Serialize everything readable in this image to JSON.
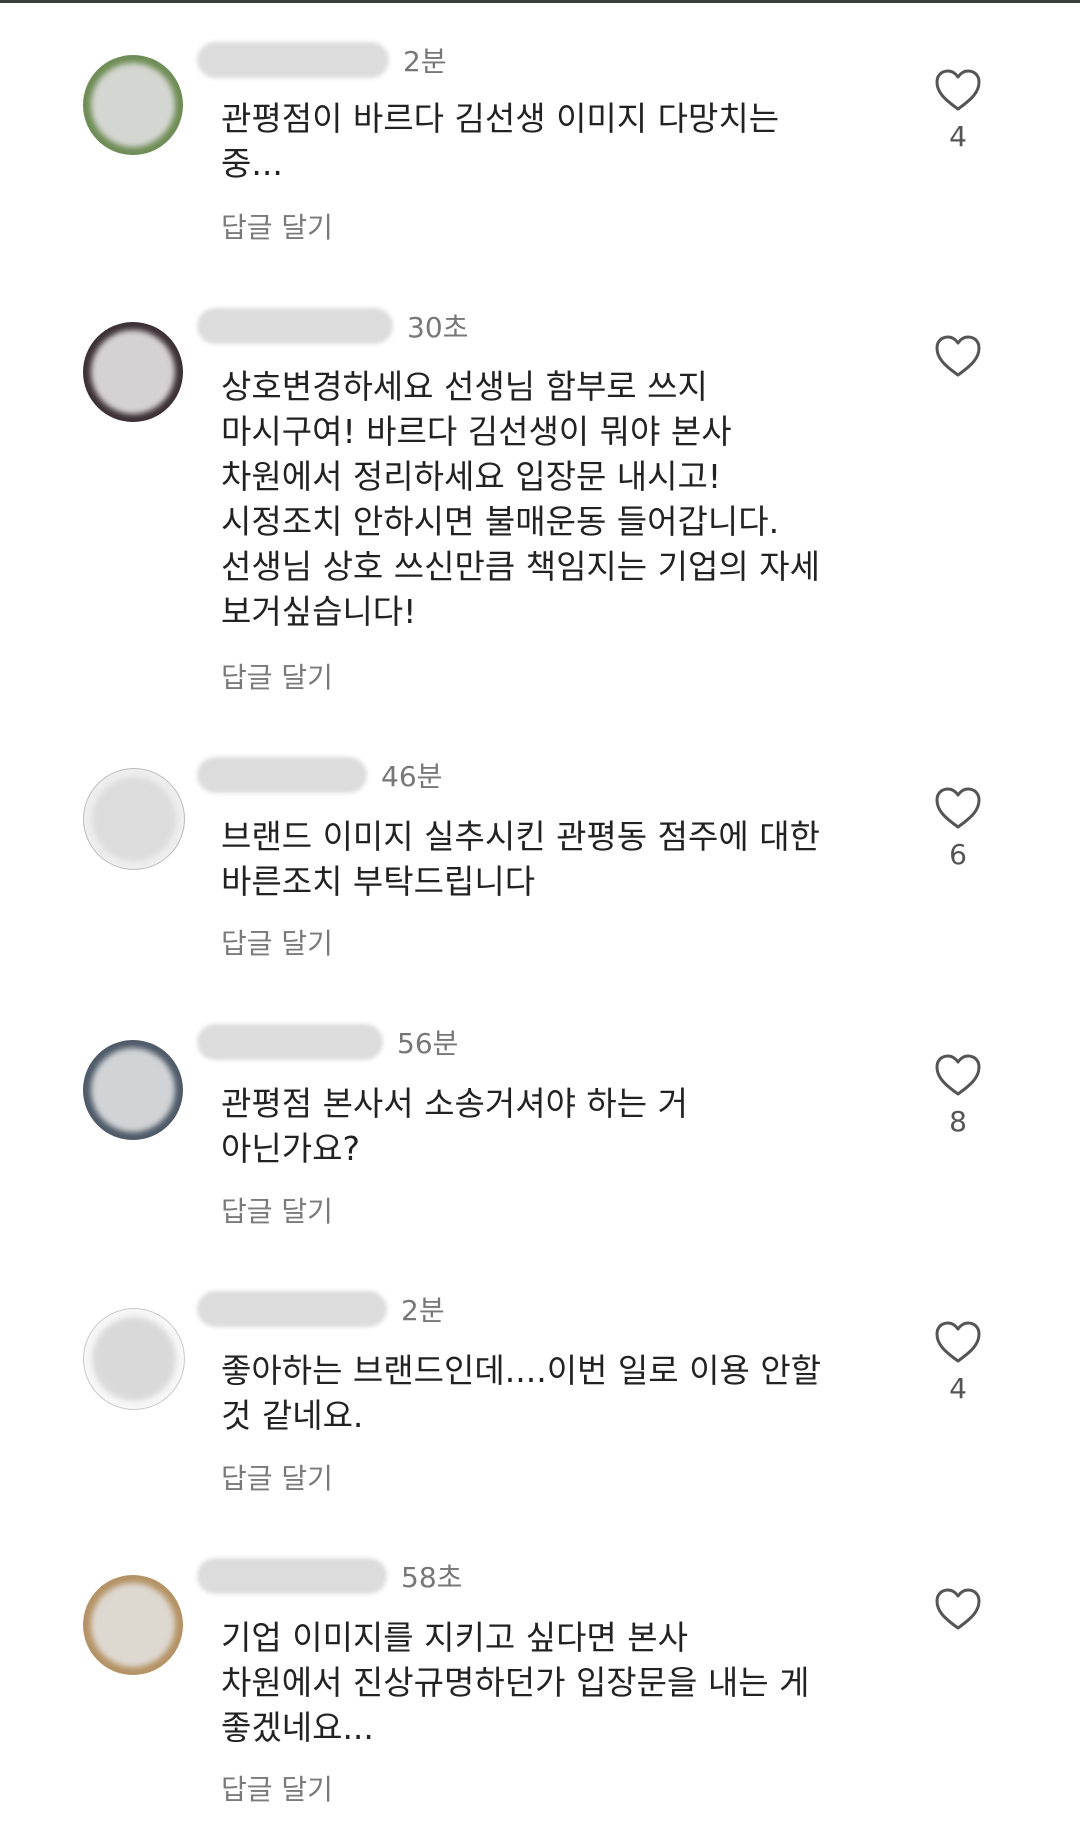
{
  "comments": [
    {
      "time": "2분",
      "text": "관평점이 바르다 김선생 이미지 다망치는\n중...",
      "reply": "답글 달기",
      "likes": "4"
    },
    {
      "time": "30초",
      "text": "상호변경하세요 선생님 함부로 쓰지\n마시구여! 바르다 김선생이 뭐야 본사\n차원에서 정리하세요 입장문 내시고!\n시정조치 안하시면 불매운동 들어갑니다.\n선생님 상호 쓰신만큼 책임지는 기업의 자세\n보거싶습니다!",
      "reply": "답글 달기",
      "likes": ""
    },
    {
      "time": "46분",
      "text": "브랜드 이미지 실추시킨 관평동 점주에 대한\n바른조치 부탁드립니다",
      "reply": "답글 달기",
      "likes": "6"
    },
    {
      "time": "56분",
      "text": "관평점 본사서 소송거셔야 하는 거\n아닌가요?",
      "reply": "답글 달기",
      "likes": "8"
    },
    {
      "time": "2분",
      "text": "좋아하는 브랜드인데....이번 일로 이용 안할\n것 같네요.",
      "reply": "답글 달기",
      "likes": "4"
    },
    {
      "time": "58초",
      "text": "기업 이미지를 지키고 싶다면 본사\n차원에서 진상규명하던가 입장문을 내는 게\n좋겠네요...",
      "reply": "답글 달기",
      "likes": ""
    }
  ],
  "icons": {
    "like": "heart-outline-icon"
  },
  "colors": {
    "text": "#222222",
    "muted": "#7a7a7a",
    "heart_stroke": "#555555"
  }
}
